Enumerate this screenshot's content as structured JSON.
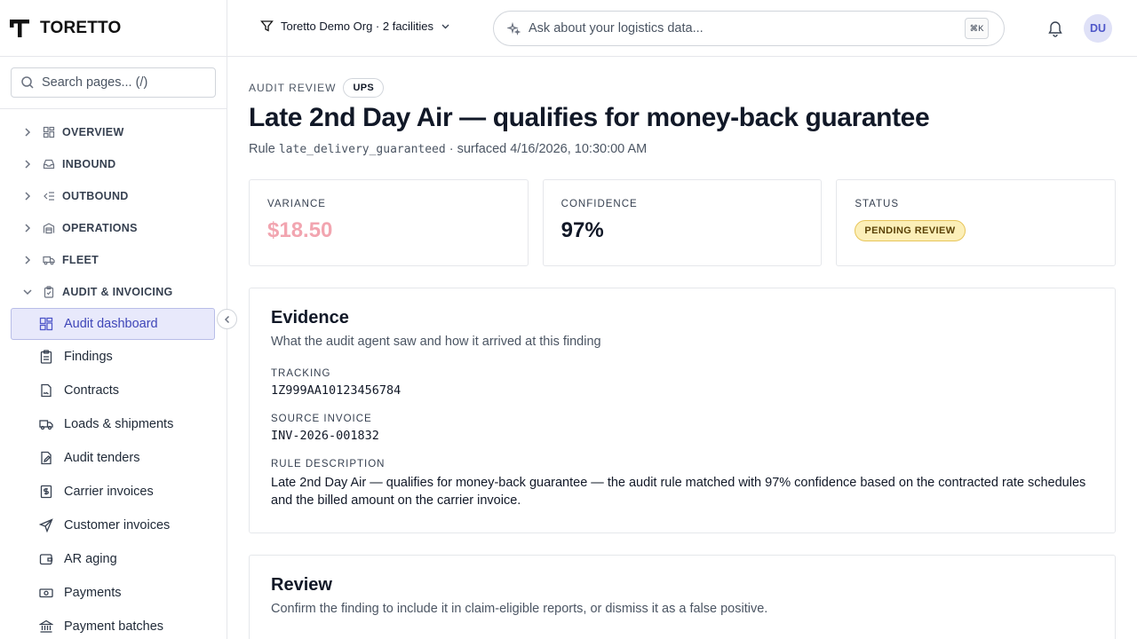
{
  "brand": {
    "name": "TORETTO"
  },
  "sidebar": {
    "search_placeholder": "Search pages...  (/)",
    "groups": [
      {
        "label": "OVERVIEW",
        "icon": "layout-grid-icon"
      },
      {
        "label": "INBOUND",
        "icon": "inbox-icon"
      },
      {
        "label": "OUTBOUND",
        "icon": "outbound-list-icon"
      },
      {
        "label": "OPERATIONS",
        "icon": "warehouse-icon"
      },
      {
        "label": "FLEET",
        "icon": "truck-icon"
      },
      {
        "label": "AUDIT & INVOICING",
        "icon": "clipboard-icon",
        "expanded": true
      }
    ],
    "items": [
      {
        "label": "Audit dashboard",
        "icon": "layout-grid-icon",
        "active": true
      },
      {
        "label": "Findings",
        "icon": "clipboard-list-icon"
      },
      {
        "label": "Contracts",
        "icon": "file-signature-icon"
      },
      {
        "label": "Loads & shipments",
        "icon": "truck-icon"
      },
      {
        "label": "Audit tenders",
        "icon": "file-edit-icon"
      },
      {
        "label": "Carrier invoices",
        "icon": "receipt-dollar-icon"
      },
      {
        "label": "Customer invoices",
        "icon": "send-icon"
      },
      {
        "label": "AR aging",
        "icon": "wallet-icon"
      },
      {
        "label": "Payments",
        "icon": "banknote-icon"
      },
      {
        "label": "Payment batches",
        "icon": "bank-icon"
      }
    ]
  },
  "topbar": {
    "org_label": "Toretto Demo Org · 2 facilities",
    "ask_placeholder": "Ask about your logistics data...",
    "shortcut": "⌘K",
    "avatar_initials": "DU"
  },
  "page": {
    "eyebrow": "AUDIT REVIEW",
    "carrier_badge": "UPS",
    "title": "Late 2nd Day Air — qualifies for money-back guarantee",
    "rule_prefix": "Rule",
    "rule_code": "late_delivery_guaranteed",
    "rule_suffix": "· surfaced 4/16/2026, 10:30:00 AM"
  },
  "stats": {
    "variance_label": "VARIANCE",
    "variance_value": "$18.50",
    "confidence_label": "CONFIDENCE",
    "confidence_value": "97%",
    "status_label": "STATUS",
    "status_value": "PENDING REVIEW"
  },
  "evidence": {
    "title": "Evidence",
    "subtitle": "What the audit agent saw and how it arrived at this finding",
    "tracking_label": "TRACKING",
    "tracking_value": "1Z999AA10123456784",
    "invoice_label": "SOURCE INVOICE",
    "invoice_value": "INV-2026-001832",
    "description_label": "RULE DESCRIPTION",
    "description_value": "Late 2nd Day Air — qualifies for money-back guarantee — the audit rule matched with 97% confidence based on the contracted rate schedules and the billed amount on the carrier invoice."
  },
  "review": {
    "title": "Review",
    "subtitle": "Confirm the finding to include it in claim-eligible reports, or dismiss it as a false positive."
  },
  "colors": {
    "accent": "#4f57c9",
    "active_bg": "#e8e9fb",
    "variance": "#f2a5b0",
    "status_bg": "#fcefb8"
  }
}
